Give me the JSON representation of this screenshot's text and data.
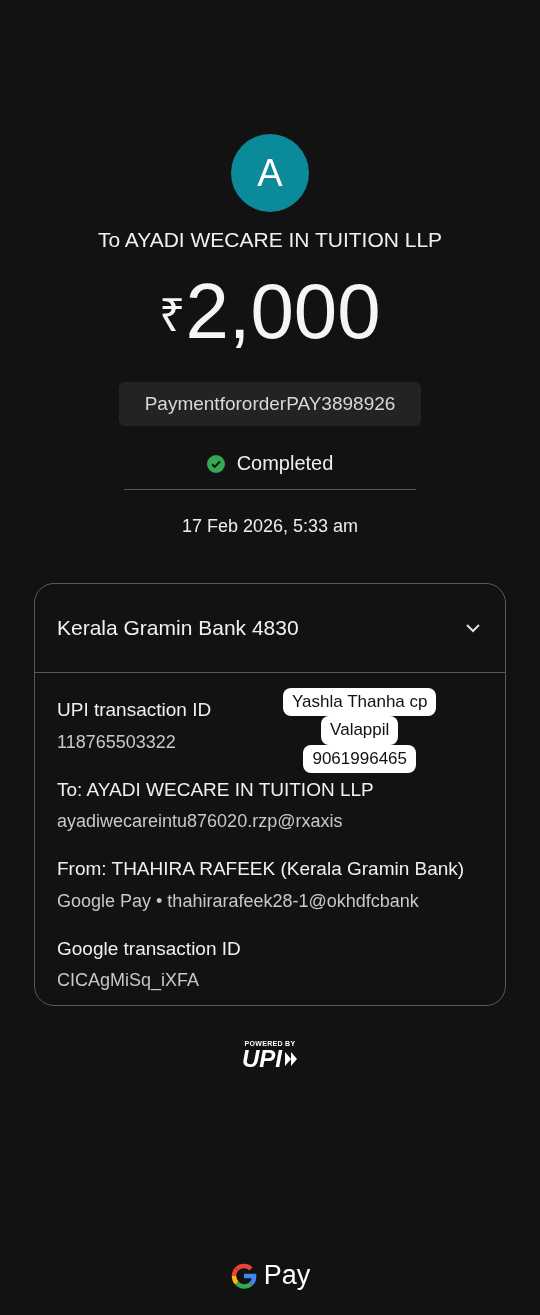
{
  "avatar": {
    "letter": "A"
  },
  "payee_title": "To AYADI WECARE IN TUITION LLP",
  "amount": {
    "currency": "₹",
    "value": "2,000"
  },
  "note": "PaymentfororderPAY3898926",
  "status": {
    "label": "Completed",
    "kind": "success"
  },
  "datetime": "17 Feb 2026, 5:33 am",
  "details": {
    "bank": "Kerala Gramin Bank 4830",
    "expanded": true,
    "rows": [
      {
        "label": "UPI transaction ID",
        "value": "118765503322"
      },
      {
        "label": "To: AYADI WECARE IN TUITION LLP",
        "value": "ayadiwecareintu876020.rzp@rxaxis"
      },
      {
        "label": "From: THAHIRA RAFEEK (Kerala Gramin Bank)",
        "value": "Google Pay • thahirarafeek28-1@okhdfcbank"
      },
      {
        "label": "Google transaction ID",
        "value": "CICAgMiSq_iXFA"
      }
    ]
  },
  "sticker": {
    "lines": [
      "Yashla Thanha cp",
      "Valappil",
      "9061996465"
    ]
  },
  "upi_badge": {
    "caption": "POWERED BY",
    "logo": "UPI"
  },
  "footer": {
    "brand": "Pay"
  }
}
